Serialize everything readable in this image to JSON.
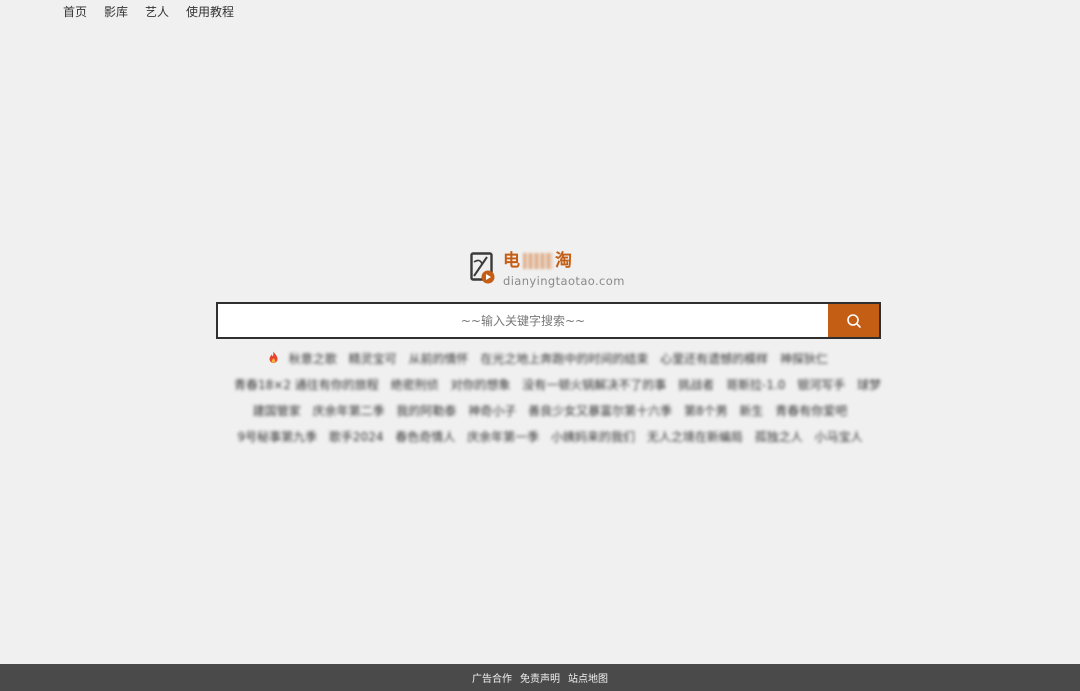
{
  "nav": {
    "items": [
      {
        "label": "首页"
      },
      {
        "label": "影库"
      },
      {
        "label": "艺人"
      },
      {
        "label": "使用教程"
      }
    ]
  },
  "logo": {
    "name_start": "电",
    "name_end": "淘",
    "domain": "dianyingtaotao.com",
    "accent_color": "#c45e14"
  },
  "search": {
    "placeholder": "~~输入关键字搜索~~",
    "button_icon": "search-icon",
    "button_color": "#c45e14"
  },
  "hot_keywords": {
    "icon": "fire-icon",
    "rows": [
      [
        "秋意之歌",
        "精灵宝可",
        "从前的情怀",
        "在光之地上奔跑中的时间的结束",
        "心里还有遗憾的模样",
        "神探狄仁"
      ],
      [
        "青春18×2 通往有你的旅程",
        "绝密刑侦",
        "对你的想象",
        "没有一顿火锅解决不了的事",
        "挑战者",
        "哥斯拉-1.0",
        "银河写手",
        "球梦"
      ],
      [
        "建国管家",
        "庆余年第二季",
        "我的阿勒泰",
        "神奇小子",
        "善良少女又暴富尔第十六季",
        "第8个男",
        "新生",
        "青春有你爱吧"
      ],
      [
        "9号秘事第九季",
        "歌手2024",
        "春色奇情人",
        "庆余年第一季",
        "小姨妈来的我们",
        "无人之境在新编局",
        "孤独之人",
        "小马宝人"
      ]
    ]
  },
  "footer": {
    "links": [
      {
        "label": "广告合作"
      },
      {
        "label": "免责声明"
      },
      {
        "label": "站点地图"
      }
    ]
  }
}
